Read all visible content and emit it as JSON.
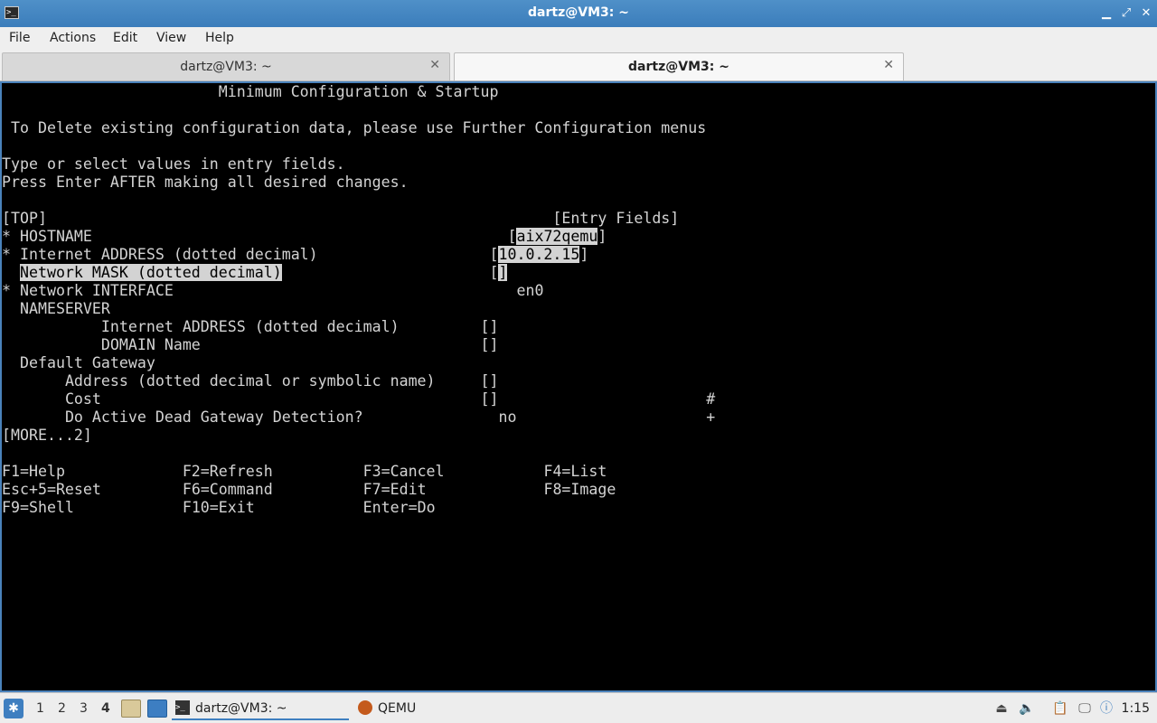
{
  "window": {
    "title": "dartz@VM3: ~",
    "controls": {
      "minimize": "▁",
      "maximize": "⤢",
      "close": "✕"
    }
  },
  "menubar": {
    "items": [
      "File",
      "Actions",
      "Edit",
      "View",
      "Help"
    ]
  },
  "tabs": [
    {
      "label": "dartz@VM3: ~",
      "active": false
    },
    {
      "label": "dartz@VM3: ~",
      "active": true
    }
  ],
  "terminal": {
    "heading": "                        Minimum Configuration & Startup",
    "notice": " To Delete existing configuration data, please use Further Configuration menus",
    "instructions": [
      "Type or select values in entry fields.",
      "Press Enter AFTER making all desired changes."
    ],
    "top_marker": "[TOP]",
    "entry_fields_header": "[Entry Fields]",
    "fields": {
      "hostname_prefix": "* ",
      "hostname_label": "HOSTNAME",
      "hostname_value": "aix72qemu",
      "ipaddr_prefix": "* ",
      "ipaddr_label": "Internet ADDRESS (dotted decimal)",
      "ipaddr_value": "10.0.2.15",
      "netmask_label": "Network MASK (dotted decimal)",
      "netmask_value": "",
      "interface_prefix": "* ",
      "interface_label": "Network INTERFACE",
      "interface_value": "en0",
      "nameserver_label": "NAMESERVER",
      "ns_addr_label": "Internet ADDRESS (dotted decimal)",
      "ns_addr_value": "",
      "domain_label": "DOMAIN Name",
      "domain_value": "",
      "gateway_label": "Default Gateway",
      "gw_addr_label": "Address (dotted decimal or symbolic name)",
      "gw_addr_value": "",
      "cost_label": "Cost",
      "cost_value": "",
      "cost_flag": "#",
      "dgd_label": "Do Active Dead Gateway Detection?",
      "dgd_value": "no",
      "dgd_flag": "+"
    },
    "more_marker": "[MORE...2]",
    "function_keys": [
      [
        "F1=Help",
        "F2=Refresh",
        "F3=Cancel",
        "F4=List"
      ],
      [
        "Esc+5=Reset",
        "F6=Command",
        "F7=Edit",
        "F8=Image"
      ],
      [
        "F9=Shell",
        "F10=Exit",
        "Enter=Do"
      ]
    ]
  },
  "taskbar": {
    "workspaces": [
      "1",
      "2",
      "3",
      "4"
    ],
    "active_workspace": "4",
    "tasks": [
      {
        "label": "dartz@VM3: ~",
        "icon": "terminal-icon"
      },
      {
        "label": "QEMU",
        "icon": "qemu-icon"
      }
    ],
    "clock": "1:15"
  }
}
